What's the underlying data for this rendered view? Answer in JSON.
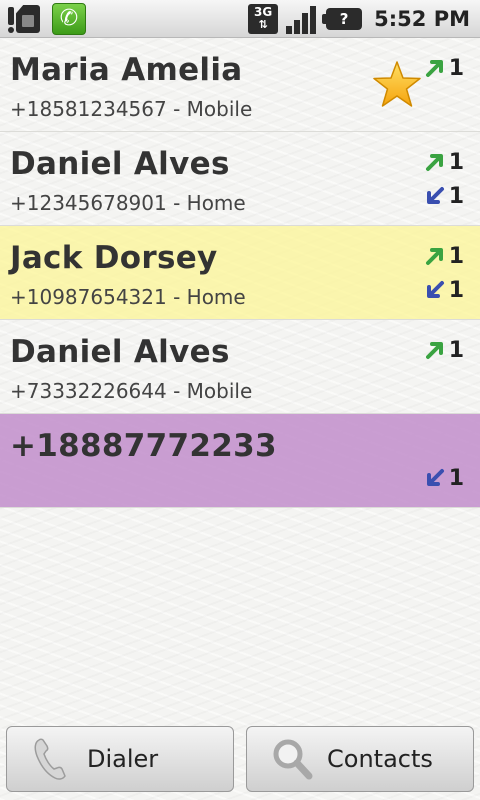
{
  "status_bar": {
    "time": "5:52 PM",
    "network_label": "3G",
    "network_arrows": "⇅",
    "battery_label": "?",
    "icons": [
      "sim-alert-icon",
      "phone-call-notification-icon",
      "network-3g-icon",
      "signal-strength-icon",
      "battery-unknown-icon"
    ]
  },
  "colors": {
    "outgoing_arrow": "#3aa341",
    "incoming_arrow": "#3a4fb0",
    "highlight_yellow": "#fbf59a",
    "highlight_purple": "#c699cf",
    "favorite_star": "#f7b716"
  },
  "calls": [
    {
      "name": "Maria Amelia",
      "detail": "+18581234567 - Mobile",
      "favorite": true,
      "outgoing": "1",
      "incoming": null,
      "highlight": null
    },
    {
      "name": "Daniel Alves",
      "detail": "+12345678901 - Home",
      "favorite": false,
      "outgoing": "1",
      "incoming": "1",
      "highlight": null
    },
    {
      "name": "Jack Dorsey",
      "detail": "+10987654321 - Home",
      "favorite": false,
      "outgoing": "1",
      "incoming": "1",
      "highlight": "yellow"
    },
    {
      "name": "Daniel Alves",
      "detail": "+73332226644 - Mobile",
      "favorite": false,
      "outgoing": "1",
      "incoming": null,
      "highlight": null
    },
    {
      "name": "+18887772233",
      "detail": "",
      "favorite": false,
      "outgoing": null,
      "incoming": "1",
      "highlight": "purple"
    }
  ],
  "buttons": {
    "dialer_label": "Dialer",
    "contacts_label": "Contacts"
  }
}
